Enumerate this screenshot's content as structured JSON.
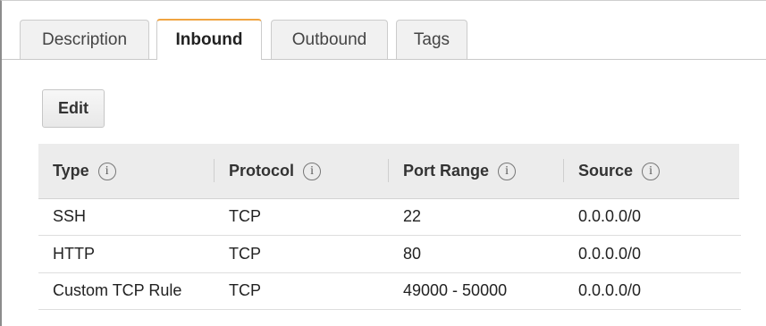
{
  "tabs": [
    {
      "label": "Description",
      "active": false
    },
    {
      "label": "Inbound",
      "active": true
    },
    {
      "label": "Outbound",
      "active": false
    },
    {
      "label": "Tags",
      "active": false
    }
  ],
  "edit_label": "Edit",
  "table": {
    "columns": [
      "Type",
      "Protocol",
      "Port Range",
      "Source"
    ],
    "rows": [
      [
        "SSH",
        "TCP",
        "22",
        "0.0.0.0/0"
      ],
      [
        "HTTP",
        "TCP",
        "80",
        "0.0.0.0/0"
      ],
      [
        "Custom TCP Rule",
        "TCP",
        "49000 - 50000",
        "0.0.0.0/0"
      ]
    ]
  },
  "icons": {
    "column_info": "info-circle-icon"
  },
  "colors": {
    "active_tab_accent": "#f0a441",
    "header_bg": "#ececec"
  }
}
